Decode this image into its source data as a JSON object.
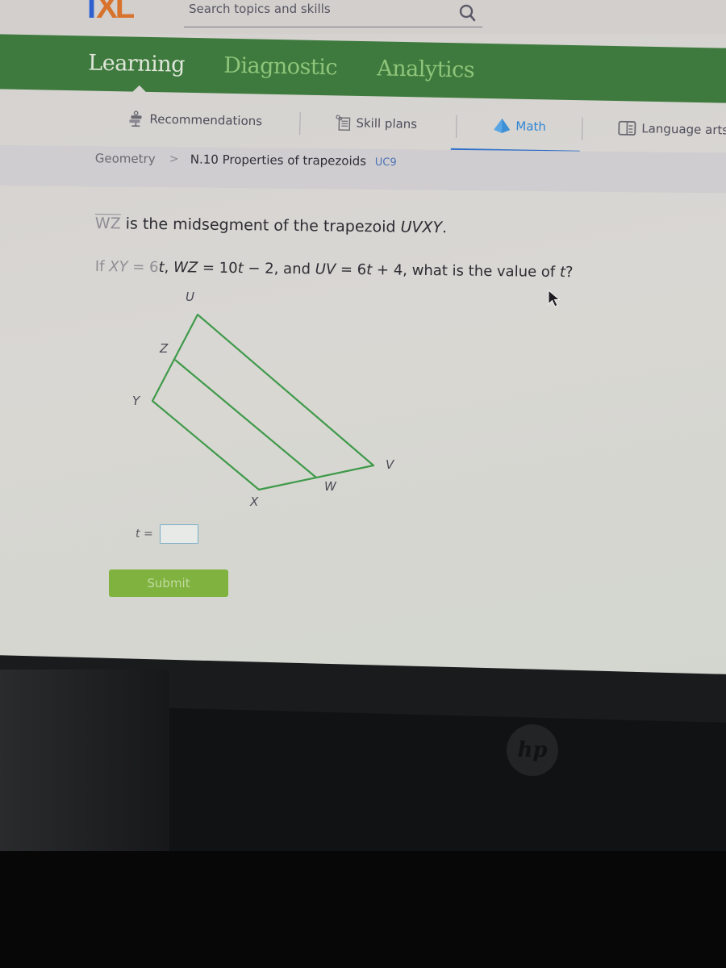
{
  "topbar": {
    "logo": {
      "i": "I",
      "xl": "XL"
    },
    "search": {
      "placeholder": "Search topics and skills",
      "value": "",
      "icon": "search-icon"
    }
  },
  "nav": {
    "items": [
      {
        "label": "Learning",
        "active": true
      },
      {
        "label": "Diagnostic",
        "active": false
      },
      {
        "label": "Analytics",
        "active": false
      }
    ],
    "brand_color": "#3e7a3d"
  },
  "subnav": {
    "items": [
      {
        "label": "Recommendations",
        "icon": "signpost-icon",
        "active": false
      },
      {
        "label": "Skill plans",
        "icon": "checklist-icon",
        "active": false
      },
      {
        "label": "Math",
        "icon": "pyramid-icon",
        "active": true
      },
      {
        "label": "Language arts",
        "icon": "book-icon",
        "active": false
      }
    ],
    "active_color": "#2f86d4"
  },
  "breadcrumb": {
    "subject": "Geometry",
    "separator": ">",
    "skill": "N.10 Properties of trapezoids",
    "code": "UC9"
  },
  "question": {
    "line1": {
      "segment": "WZ",
      "text": " is the midsegment of the trapezoid ",
      "shape": "UVXY",
      "end": "."
    },
    "line2": {
      "prefix": "If ",
      "xy_name": "XY",
      "xy_eq": " = 6",
      "var": "t",
      "sep1": ", ",
      "wz_name": "WZ",
      "wz_eq": " = 10",
      "wz_tail": " − 2, and ",
      "uv_name": "UV",
      "uv_eq": " = 6",
      "uv_tail": " + 4, what is the value of ",
      "end": "?"
    }
  },
  "figure": {
    "vertices": {
      "U": "U",
      "Z": "Z",
      "Y": "Y",
      "X": "X",
      "W": "W",
      "V": "V"
    },
    "line_color": "#3f9a4a"
  },
  "answer": {
    "label": "t =",
    "value": "",
    "submit_label": "Submit",
    "submit_color": "#7fb23e"
  },
  "device": {
    "logo": "hp"
  }
}
